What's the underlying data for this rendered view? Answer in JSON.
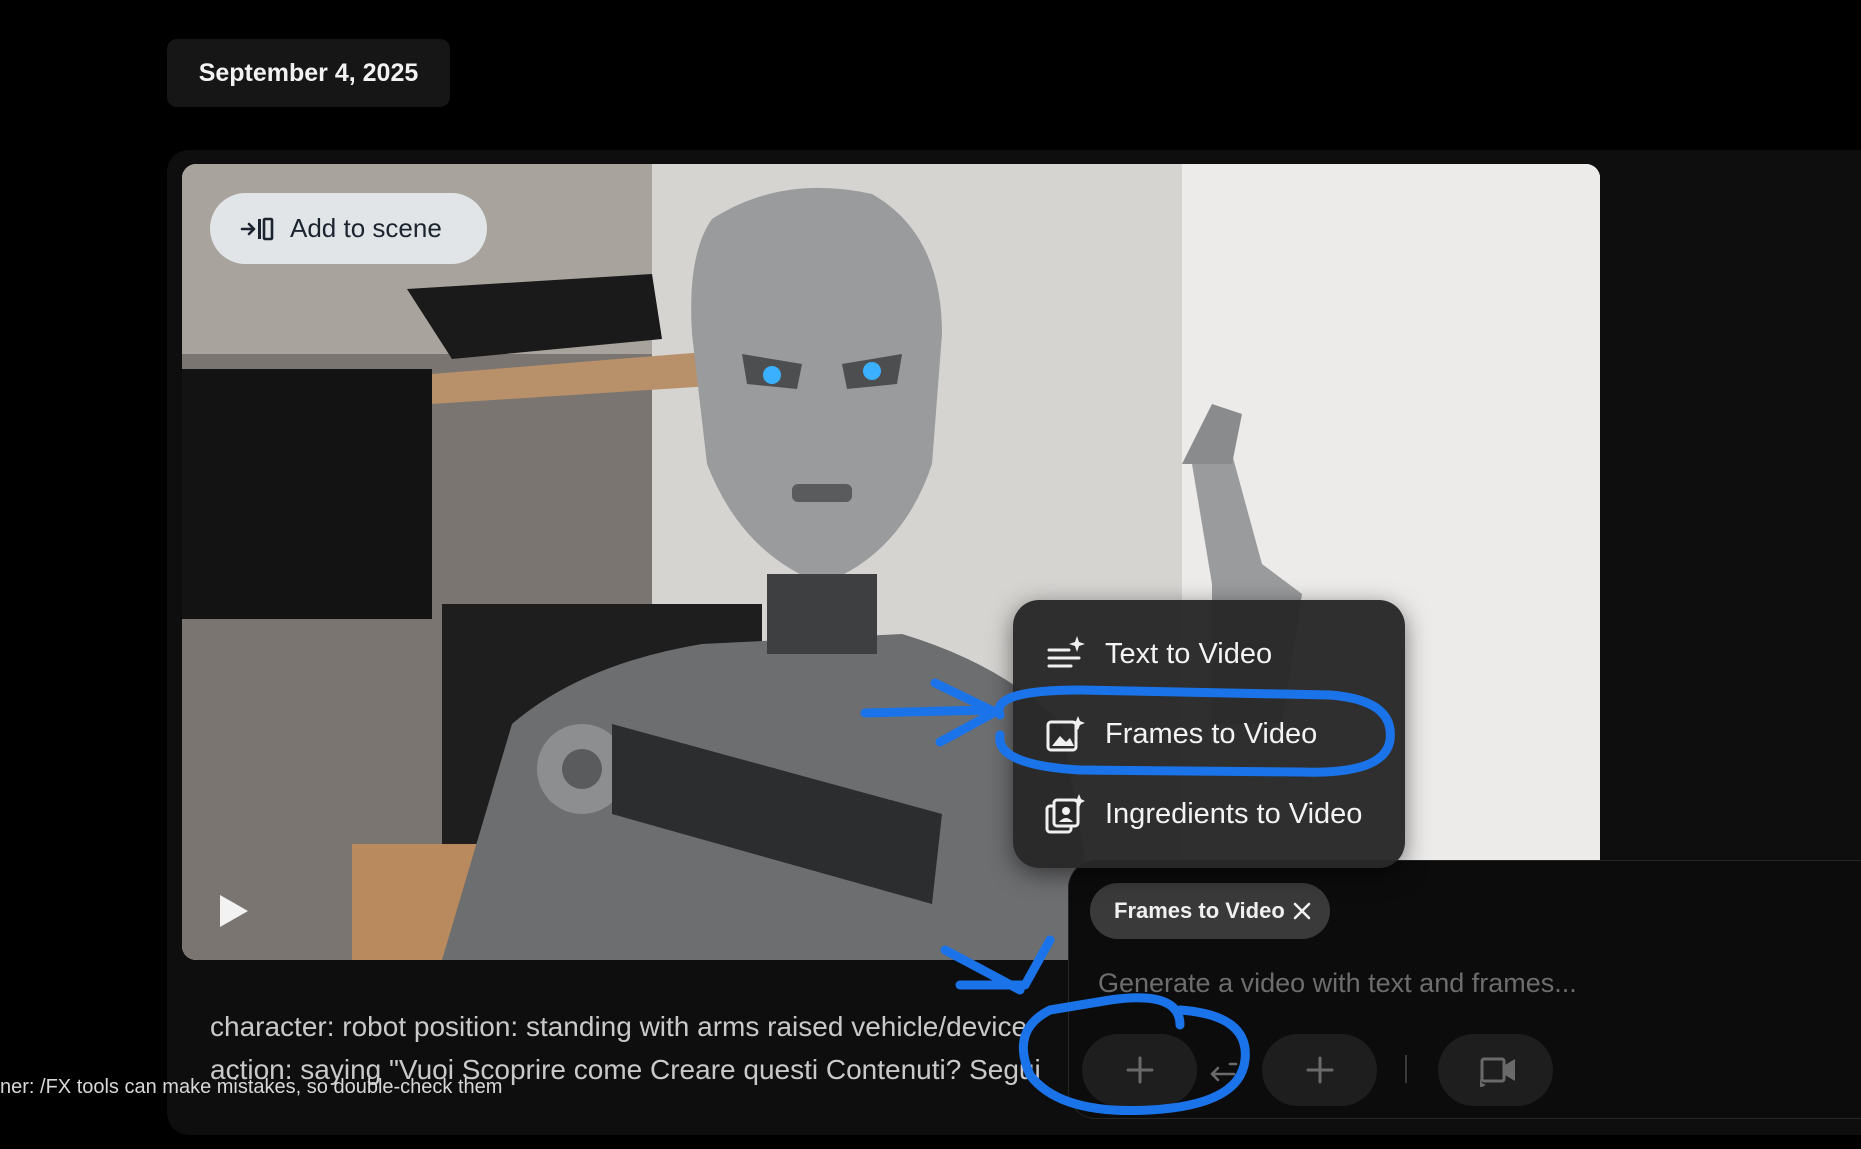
{
  "date": "September 4, 2025",
  "video": {
    "add_to_scene_label": "Add to scene",
    "prompt_line1": "character: robot position: standing with arms raised vehicle/device",
    "prompt_line2": "action: saying \"Vuoi Scoprire come Creare questi Contenuti? Segui"
  },
  "disclaimer": "ner: /FX tools can make mistakes, so double-check them",
  "menu": {
    "items": [
      {
        "label": "Text to Video",
        "icon": "text-sparkle-icon"
      },
      {
        "label": "Frames to Video",
        "icon": "image-sparkle-icon"
      },
      {
        "label": "Ingredients to Video",
        "icon": "ingredients-icon"
      }
    ]
  },
  "composer": {
    "mode_label": "Frames to Video",
    "placeholder": "Generate a video with text and frames..."
  },
  "colors": {
    "annotation_blue": "#1a73e8",
    "chip_bg": "#3a3a3a",
    "menu_bg": "#282828"
  }
}
